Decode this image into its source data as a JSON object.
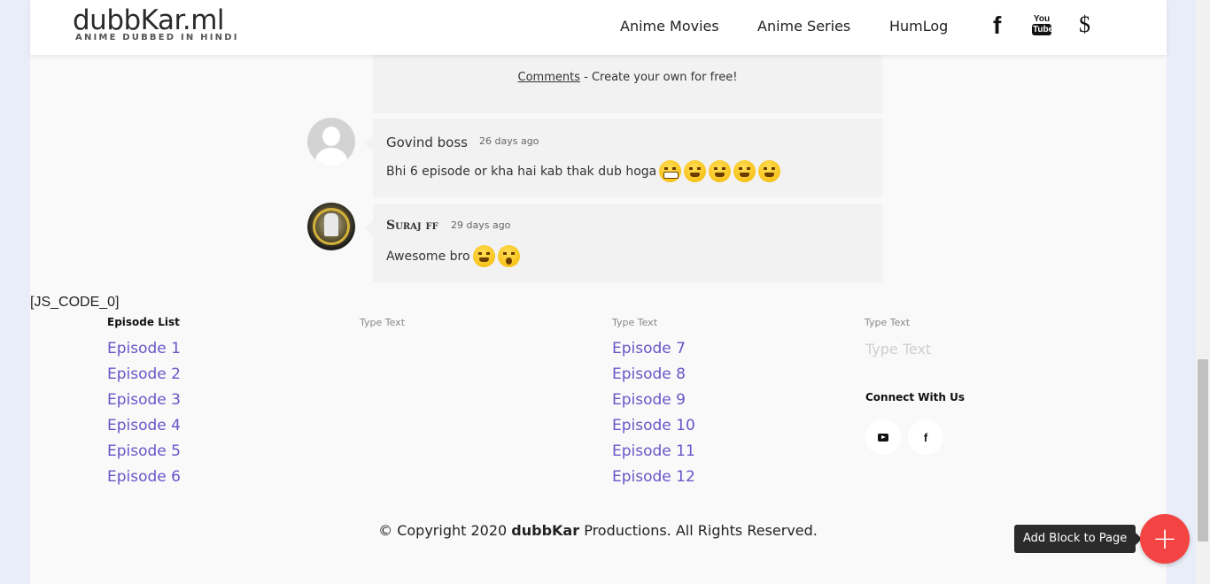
{
  "header": {
    "logo_title": "dubbKar.ml",
    "logo_subtitle": "ANIME DUBBED IN HINDI",
    "nav": [
      {
        "label": "Anime Movies"
      },
      {
        "label": "Anime Series"
      },
      {
        "label": "HumLog"
      }
    ],
    "icons": {
      "facebook": "f",
      "youtube_top": "You",
      "youtube_bottom": "Tube",
      "donate": "$"
    }
  },
  "comments": {
    "footer_link": "Comments",
    "footer_text": " - Create your own for free!",
    "items": [
      {
        "author": "Govind boss",
        "time": "26 days ago",
        "text": "Bhi 6 episode or kha hai kab thak dub hoga"
      },
      {
        "author": "Suraj ff",
        "time": "29 days ago",
        "text": "Awesome bro"
      }
    ]
  },
  "js_marker": "[JS_CODE_0]",
  "footer": {
    "episode_heading": "Episode List",
    "col2_placeholder": "Type Text",
    "col3_placeholder": "Type Text",
    "col4_placeholder": "Type Text",
    "col4_big_placeholder": "Type Text",
    "episodes_left": [
      "Episode 1",
      "Episode 2",
      "Episode 3",
      "Episode 4",
      "Episode 5",
      "Episode 6"
    ],
    "episodes_right": [
      "Episode 7",
      "Episode 8",
      "Episode 9",
      "Episode 10",
      "Episode 11",
      "Episode 12"
    ],
    "connect_heading": "Connect With Us",
    "social": {
      "facebook": "f"
    }
  },
  "copyright": {
    "prefix": "© Copyright 2020 ",
    "brand": "dubbKar",
    "suffix": " Productions. All Rights Reserved."
  },
  "add_block": {
    "tooltip": "Add Block to Page",
    "button": "+"
  },
  "colors": {
    "link": "#6a55c8",
    "fab": "#f44343"
  }
}
